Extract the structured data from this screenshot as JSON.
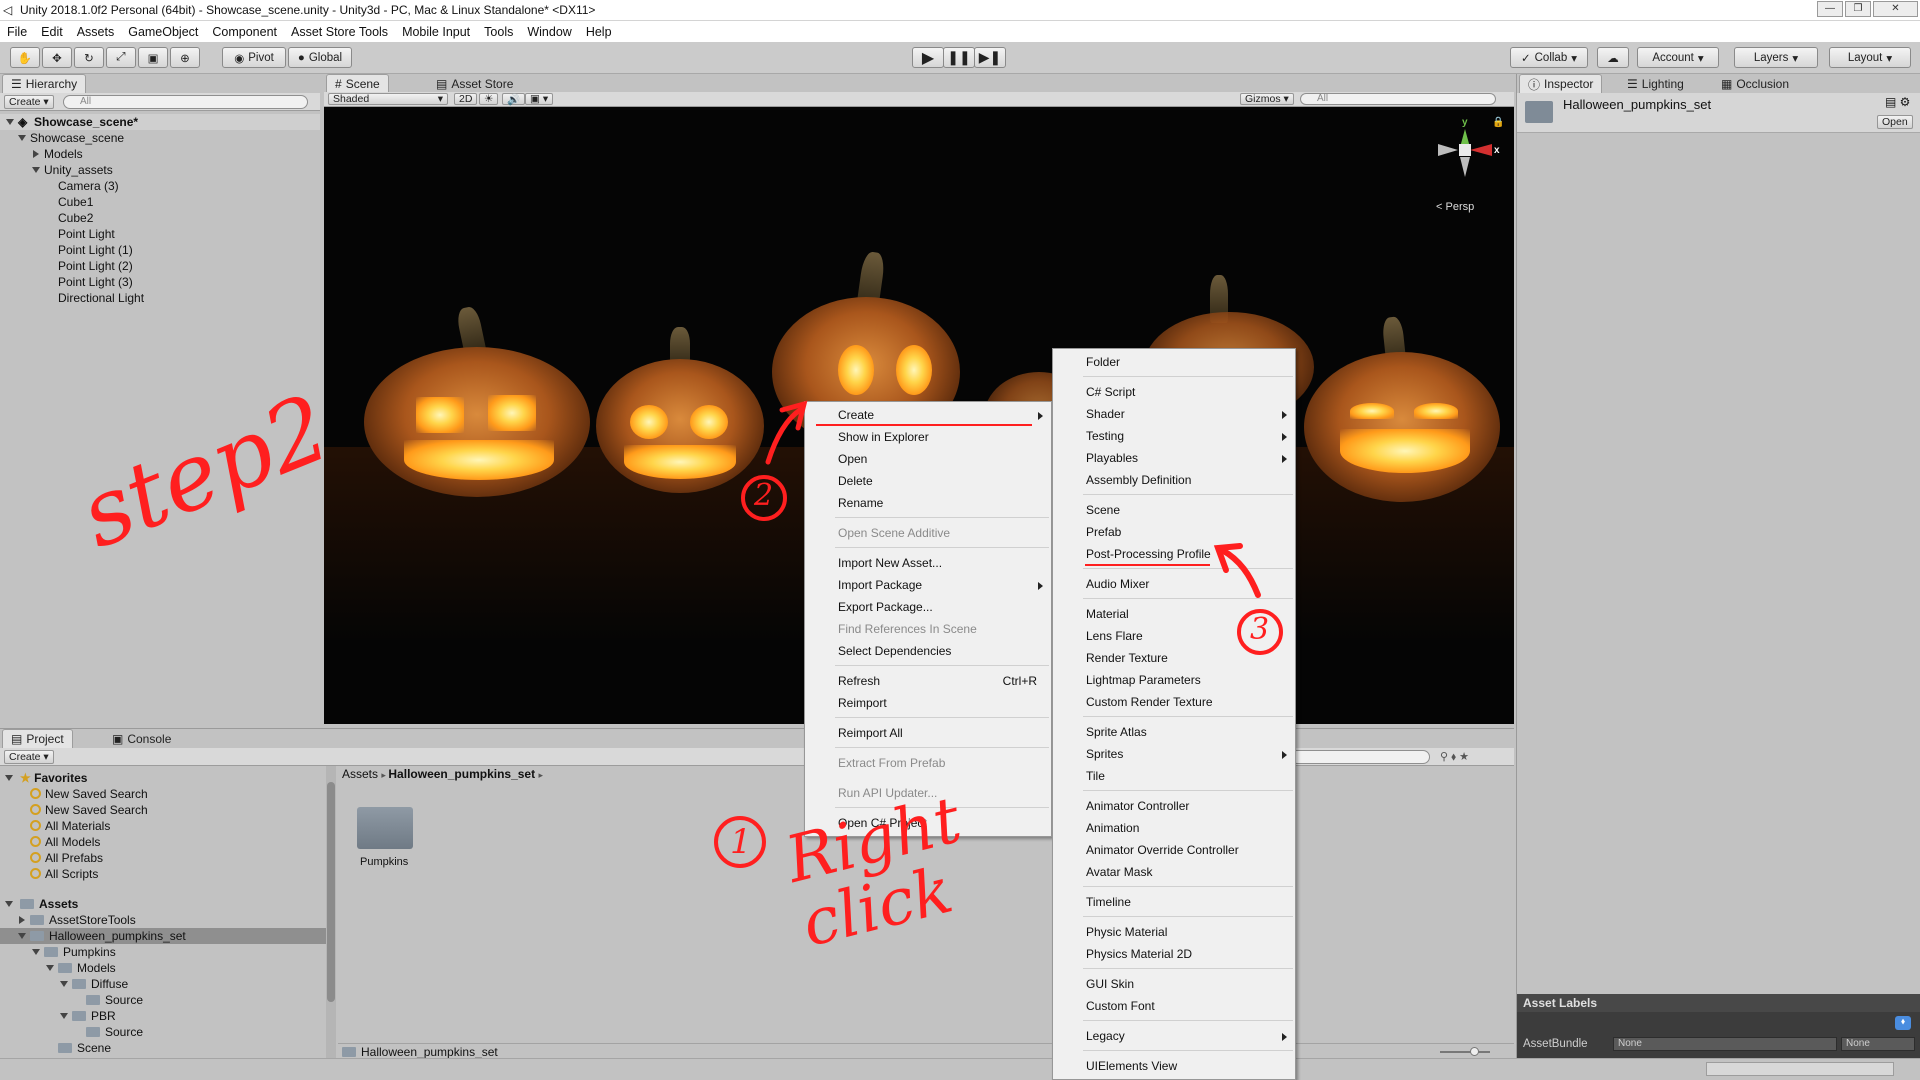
{
  "window": {
    "title": "Unity 2018.1.0f2 Personal (64bit) - Showcase_scene.unity - Unity3d - PC, Mac & Linux Standalone* <DX11>"
  },
  "menubar": [
    "File",
    "Edit",
    "Assets",
    "GameObject",
    "Component",
    "Asset Store Tools",
    "Mobile Input",
    "Tools",
    "Window",
    "Help"
  ],
  "toolbar": {
    "pivot": "Pivot",
    "global": "Global",
    "collab": "Collab",
    "account": "Account",
    "layers": "Layers",
    "layout": "Layout"
  },
  "hierarchy": {
    "tab": "Hierarchy",
    "create": "Create",
    "search_placeholder": "All",
    "scene": "Showcase_scene*",
    "items": [
      "Showcase_scene",
      "Models",
      "Unity_assets",
      "Camera (3)",
      "Cube1",
      "Cube2",
      "Point Light",
      "Point Light (1)",
      "Point Light (2)",
      "Point Light (3)",
      "Directional Light"
    ]
  },
  "scene": {
    "tab": "Scene",
    "asset_store_tab": "Asset Store",
    "shading": "Shaded",
    "mode2d": "2D",
    "gizmos": "Gizmos",
    "search_placeholder": "All",
    "persp": "Persp",
    "axis_y": "y",
    "axis_x": "x"
  },
  "inspector": {
    "tab": "Inspector",
    "lighting_tab": "Lighting",
    "occlusion_tab": "Occlusion",
    "asset_name": "Halloween_pumpkins_set",
    "open": "Open",
    "asset_labels": "Asset Labels",
    "asset_bundle": "AssetBundle",
    "bundle_value": "None",
    "variant_value": "None"
  },
  "project": {
    "tab": "Project",
    "console_tab": "Console",
    "create": "Create",
    "favorites_label": "Favorites",
    "favorites": [
      "New Saved Search",
      "New Saved Search",
      "All Materials",
      "All Models",
      "All Prefabs",
      "All Scripts"
    ],
    "assets_label": "Assets",
    "assets": [
      "AssetStoreTools",
      "Halloween_pumpkins_set",
      "Pumpkins",
      "Models",
      "Diffuse",
      "Source",
      "PBR",
      "Source",
      "Scene"
    ],
    "breadcrumb_root": "Assets",
    "breadcrumb_folder": "Halloween_pumpkins_set",
    "grid_item": "Pumpkins",
    "footer_path": "Halloween_pumpkins_set"
  },
  "context_menu": [
    {
      "label": "Create",
      "arrow": true
    },
    {
      "label": "Show in Explorer"
    },
    {
      "label": "Open"
    },
    {
      "label": "Delete"
    },
    {
      "label": "Rename"
    },
    {
      "label": "Open Scene Additive",
      "disabled": true
    },
    {
      "label": "Import New Asset..."
    },
    {
      "label": "Import Package",
      "arrow": true
    },
    {
      "label": "Export Package..."
    },
    {
      "label": "Find References In Scene",
      "disabled": true
    },
    {
      "label": "Select Dependencies"
    },
    {
      "label": "Refresh",
      "shortcut": "Ctrl+R"
    },
    {
      "label": "Reimport"
    },
    {
      "label": "Reimport All"
    },
    {
      "label": "Extract From Prefab",
      "disabled": true
    },
    {
      "label": "Run API Updater...",
      "disabled": true
    },
    {
      "label": "Open C# Project"
    }
  ],
  "create_submenu": [
    {
      "label": "Folder"
    },
    {
      "label": "C# Script"
    },
    {
      "label": "Shader",
      "arrow": true
    },
    {
      "label": "Testing",
      "arrow": true
    },
    {
      "label": "Playables",
      "arrow": true
    },
    {
      "label": "Assembly Definition"
    },
    {
      "label": "Scene"
    },
    {
      "label": "Prefab"
    },
    {
      "label": "Post-Processing Profile"
    },
    {
      "label": "Audio Mixer"
    },
    {
      "label": "Material"
    },
    {
      "label": "Lens Flare"
    },
    {
      "label": "Render Texture"
    },
    {
      "label": "Lightmap Parameters"
    },
    {
      "label": "Custom Render Texture"
    },
    {
      "label": "Sprite Atlas"
    },
    {
      "label": "Sprites",
      "arrow": true
    },
    {
      "label": "Tile"
    },
    {
      "label": "Animator Controller"
    },
    {
      "label": "Animation"
    },
    {
      "label": "Animator Override Controller"
    },
    {
      "label": "Avatar Mask"
    },
    {
      "label": "Timeline"
    },
    {
      "label": "Physic Material"
    },
    {
      "label": "Physics Material 2D"
    },
    {
      "label": "GUI Skin"
    },
    {
      "label": "Custom Font"
    },
    {
      "label": "Legacy",
      "arrow": true
    },
    {
      "label": "UIElements View"
    }
  ],
  "annotations": {
    "step": "step2",
    "right_click": "Right click",
    "n1": "1",
    "n2": "2",
    "n3": "3"
  },
  "colors": {
    "annotation": "#ff1f1f",
    "selection": "#3d6fbf",
    "scene_bg": "#050505"
  }
}
